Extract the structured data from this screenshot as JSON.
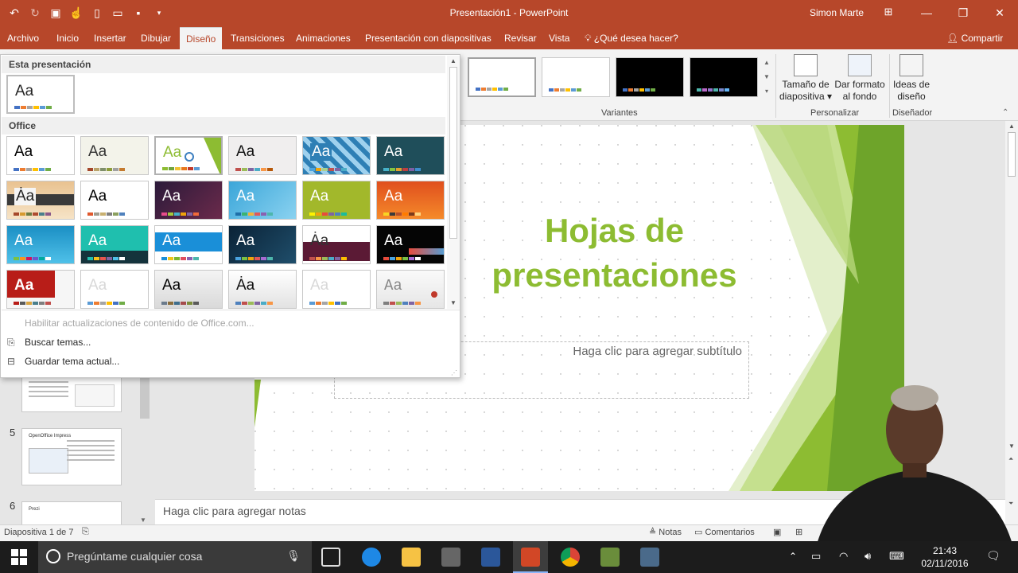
{
  "window": {
    "title": "Presentación1 - PowerPoint",
    "user": "Simon Marte",
    "controls": [
      "—",
      "❐",
      "✕"
    ]
  },
  "qat": {
    "icons": [
      "undo-icon",
      "redo-icon",
      "slideshow-icon",
      "touch-mode-icon",
      "new-icon",
      "open-icon",
      "save-icon",
      "customize-icon"
    ]
  },
  "tabs": [
    {
      "label": "Archivo"
    },
    {
      "label": "Inicio"
    },
    {
      "label": "Insertar"
    },
    {
      "label": "Dibujar"
    },
    {
      "label": "Diseño",
      "active": true
    },
    {
      "label": "Transiciones"
    },
    {
      "label": "Animaciones"
    },
    {
      "label": "Presentación con diapositivas"
    },
    {
      "label": "Revisar"
    },
    {
      "label": "Vista"
    },
    {
      "label": "¿Qué desea hacer?"
    }
  ],
  "share_label": "Compartir",
  "ribbon": {
    "variants_label": "Variantes",
    "customize_label": "Personalizar",
    "designer_group_label": "Diseñador",
    "slide_size": "Tamaño de diapositiva",
    "format_background": "Dar formato al fondo",
    "design_ideas": "Ideas de diseño",
    "slide_size_l1": "Tamaño de",
    "slide_size_l2": "diapositiva ▾",
    "format_bg_l1": "Dar formato",
    "format_bg_l2": "al fondo",
    "ideas_l1": "Ideas de",
    "ideas_l2": "diseño"
  },
  "dropdown": {
    "this_presentation": "Esta presentación",
    "office": "Office",
    "enable_updates": "Habilitar actualizaciones de contenido de Office.com...",
    "browse_themes": "Buscar temas...",
    "save_theme": "Guardar tema actual...",
    "aa": "Aa",
    "aa_alt": "Ȧa"
  },
  "slide": {
    "title": "Hojas de presentaciones",
    "subtitle_placeholder": "Haga clic para agregar subtítulo",
    "accent": "#8dbc32"
  },
  "notes_placeholder": "Haga clic para agregar notas",
  "slidepane": {
    "numbers": [
      "5",
      "6"
    ],
    "thumb5_title": "OpenOffice Impress",
    "thumb6_title": "Prezi"
  },
  "status": {
    "slide_info": "Diapositiva 1 de 7",
    "notes": "Notas",
    "comments": "Comentarios"
  },
  "taskbar": {
    "search_placeholder": "Pregúntame cualquier cosa",
    "time": "21:43",
    "date": "02/11/2016"
  },
  "colors": {
    "brand": "#b7472a",
    "ribbon_bg": "#f3f3f3"
  }
}
